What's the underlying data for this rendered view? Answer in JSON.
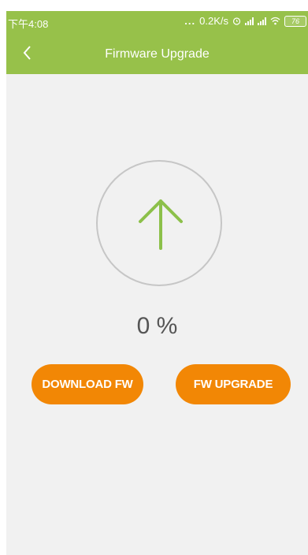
{
  "status_bar": {
    "time": "下午4:08",
    "dots": "...",
    "speed": "0.2K/s",
    "battery": "76"
  },
  "nav": {
    "back_icon": "chevron-left-icon",
    "title": "Firmware Upgrade"
  },
  "progress": {
    "icon": "arrow-up-icon",
    "value": 0,
    "text": "0 %"
  },
  "buttons": {
    "download_label": "DOWNLOAD FW",
    "upgrade_label": "FW UPGRADE"
  },
  "colors": {
    "header": "#97c14a",
    "accent_green": "#8cc04a",
    "button_orange": "#f28705",
    "background": "#f1f1f1",
    "circle_border": "#c6c6c6"
  }
}
